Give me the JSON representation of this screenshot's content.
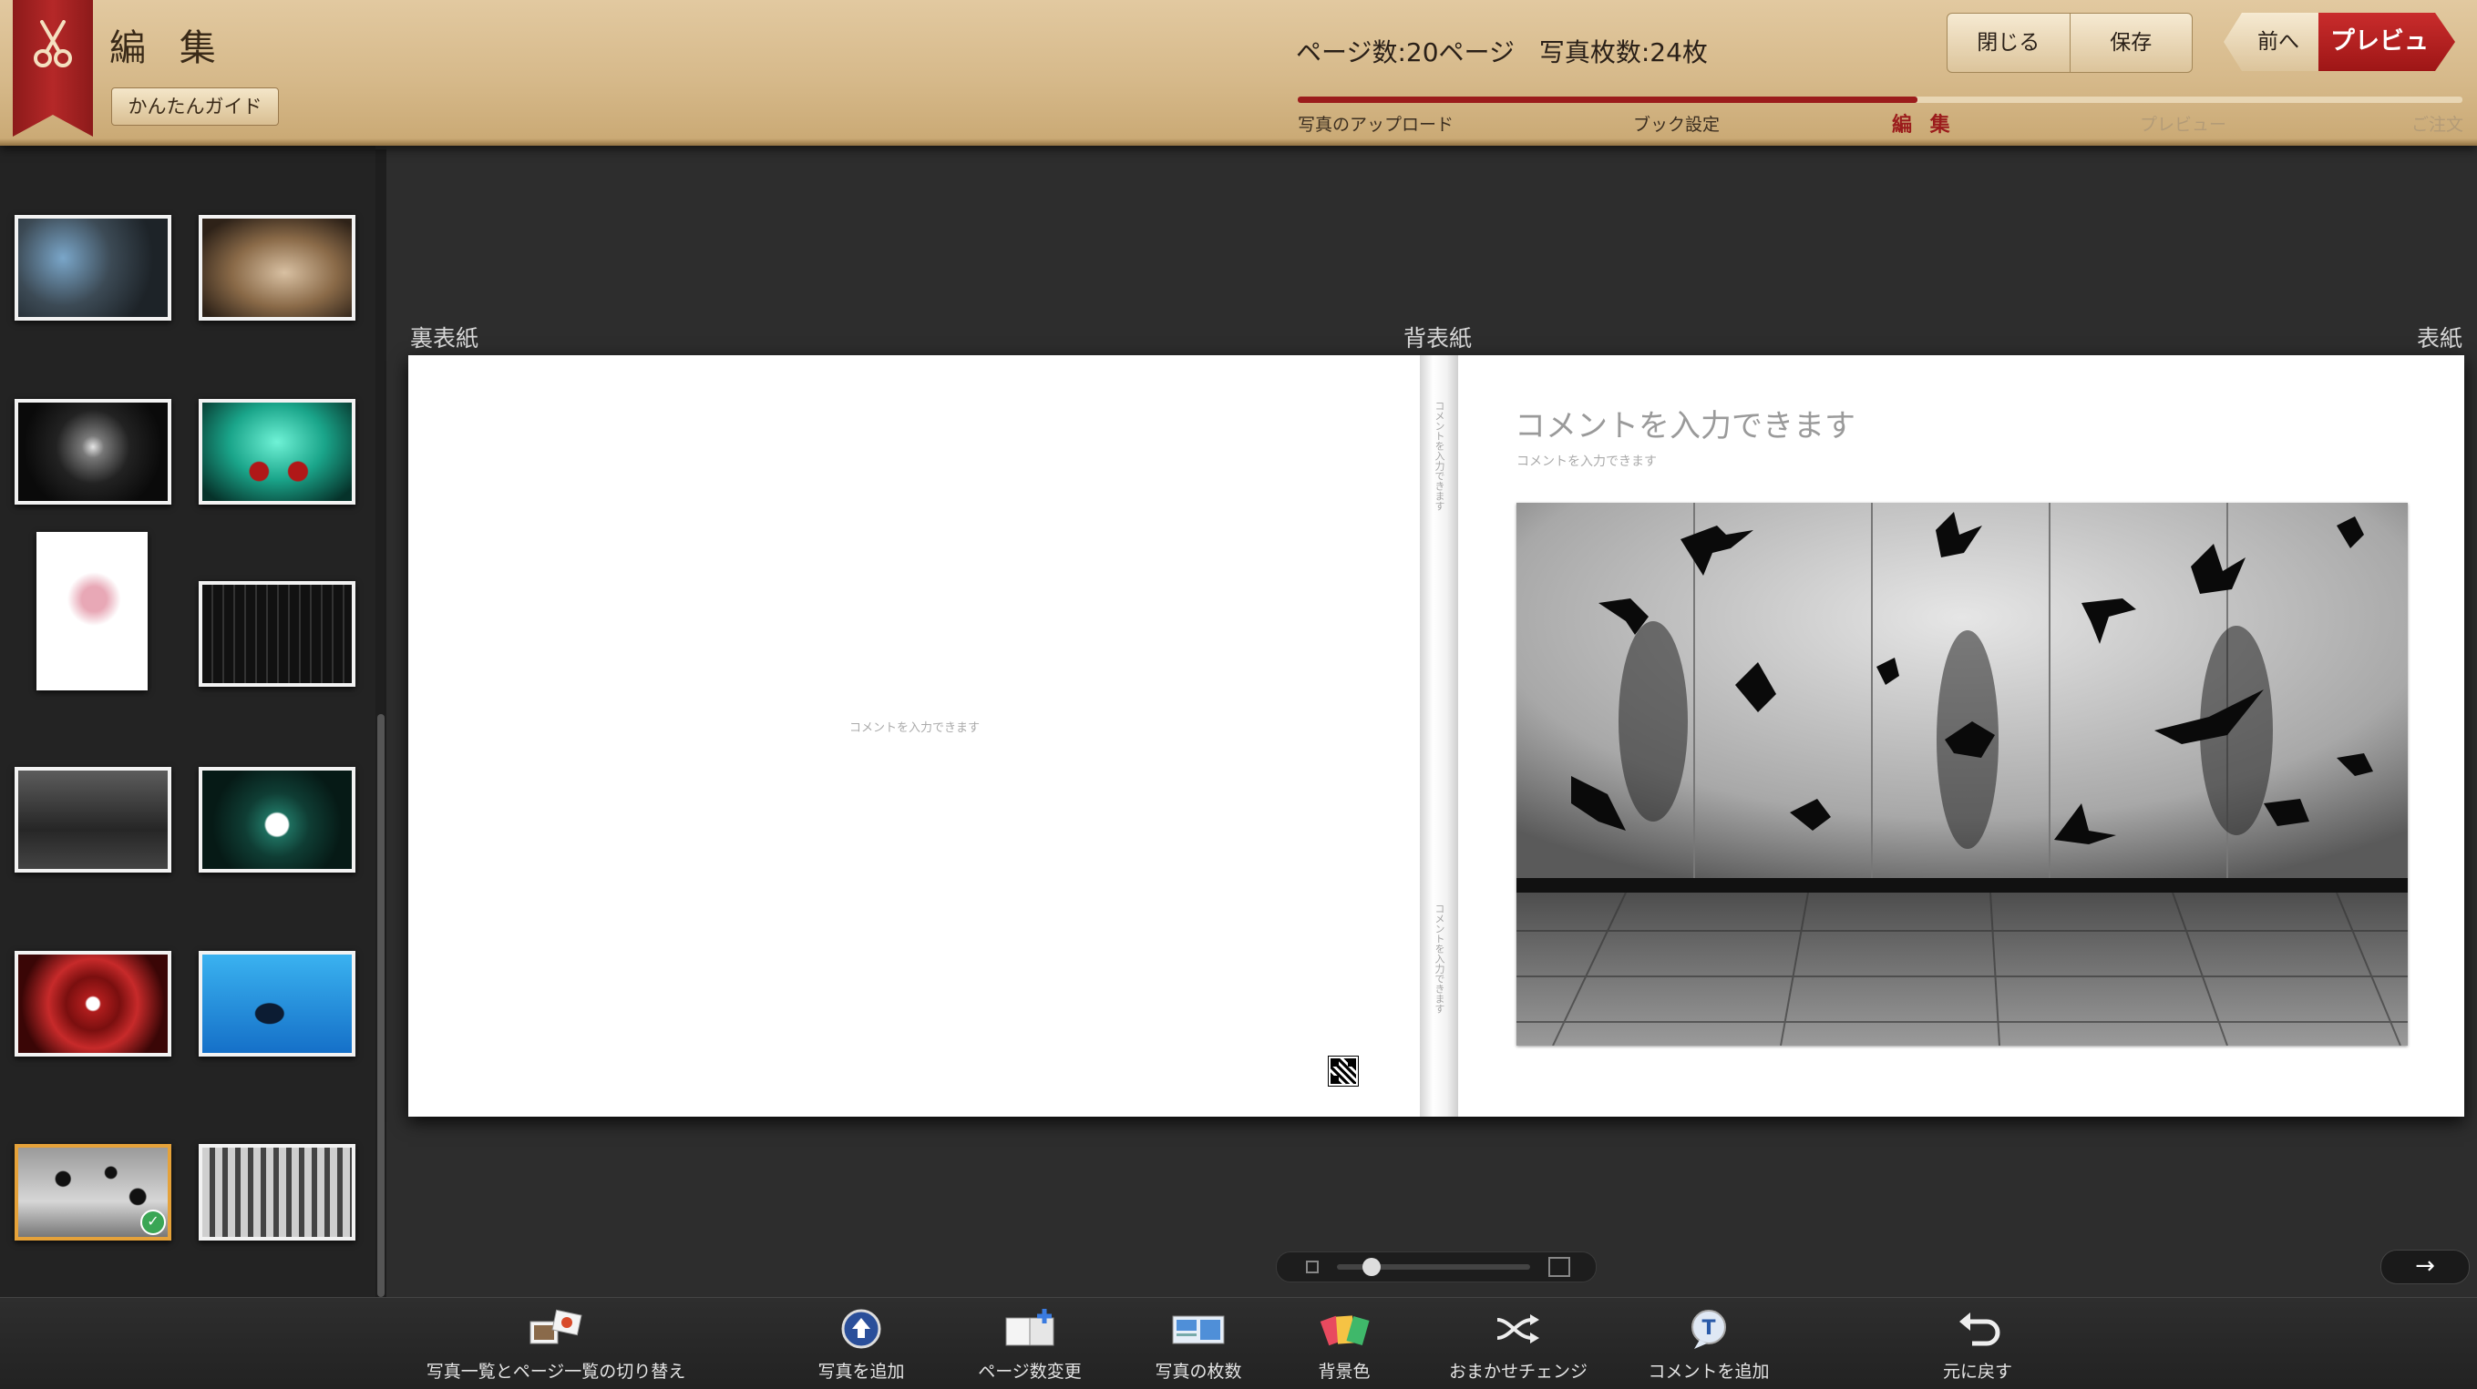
{
  "header": {
    "mode_title": "編 集",
    "guide_button": "かんたんガイド",
    "page_count": "ページ数:20ページ",
    "photo_count": "写真枚数:24枚",
    "close_button": "閉じる",
    "save_button": "保存",
    "prev_button": "前へ",
    "preview_button": "プレビュー",
    "steps": [
      "写真のアップロード",
      "ブック設定",
      "編 集",
      "プレビュー",
      "ご注文"
    ],
    "active_step_index": 2,
    "accent_color": "#9b1c1c"
  },
  "sidebar": {
    "thumbnails": [
      "thumb-1",
      "thumb-2",
      "thumb-3",
      "thumb-4",
      "thumb-5",
      "thumb-6",
      "thumb-7",
      "thumb-8",
      "thumb-9",
      "thumb-10",
      "thumb-11",
      "thumb-12"
    ],
    "selected_index": 10
  },
  "spread": {
    "back_cover_label": "裏表紙",
    "spine_label": "背表紙",
    "front_cover_label": "表紙",
    "back_comment": "コメントを入力できます",
    "spine_comment_top": "コメントを入力できます",
    "spine_comment_bottom": "コメントを入力できます",
    "front_title": "コメントを入力できます",
    "front_subtitle": "コメントを入力できます"
  },
  "zoom": {
    "level": 0.15
  },
  "toolbar": {
    "switch_view": "写真一覧とページ一覧の切り替え",
    "add_photo": "写真を追加",
    "change_pages": "ページ数変更",
    "photo_count": "写真の枚数",
    "background_color": "背景色",
    "auto_change": "おまかせチェンジ",
    "add_comment": "コメントを追加",
    "undo": "元に戻す"
  }
}
